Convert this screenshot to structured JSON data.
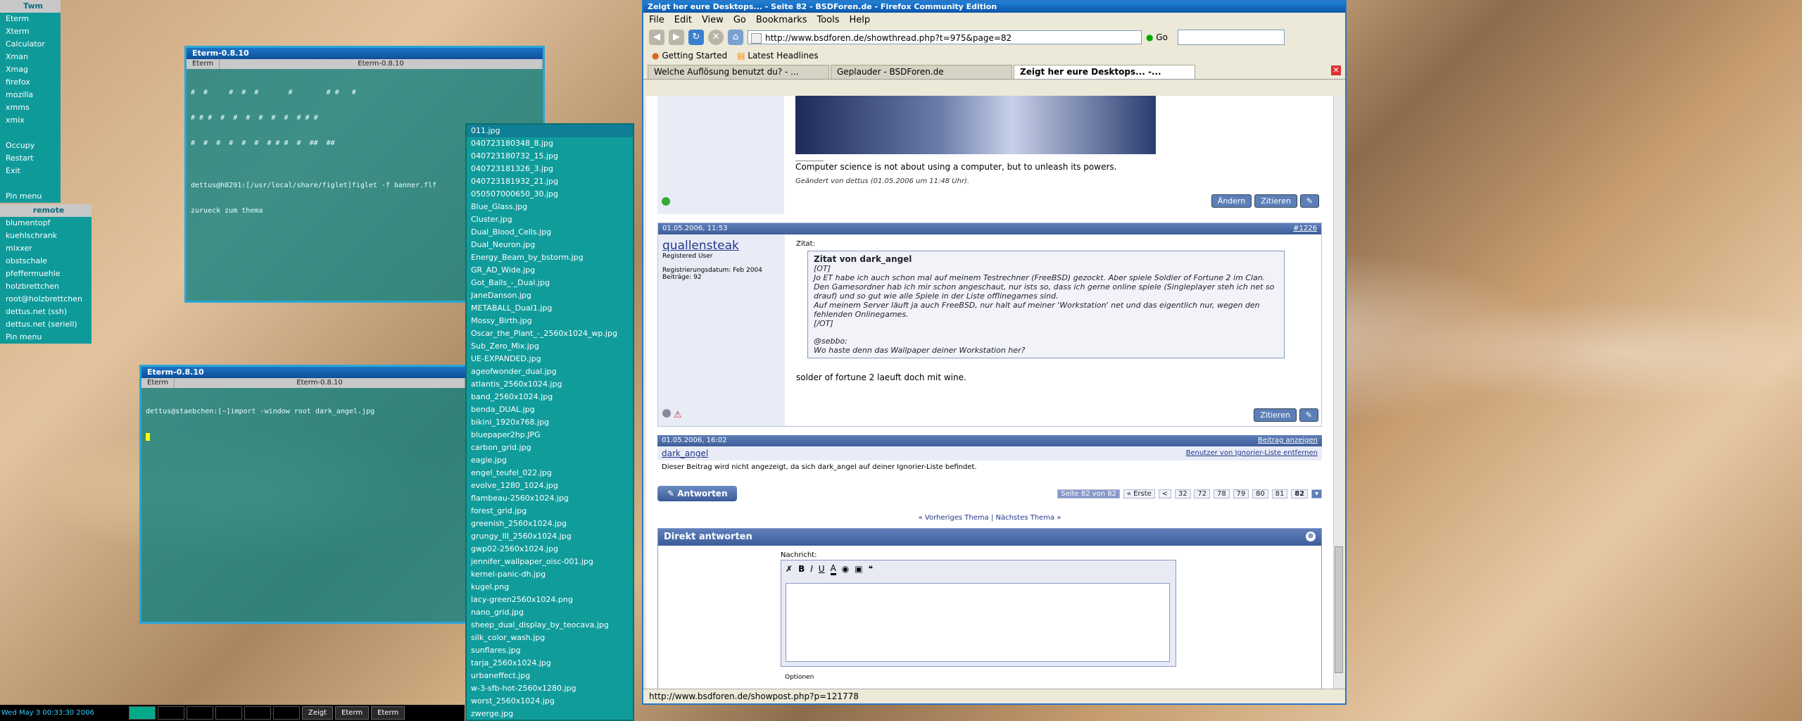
{
  "desktop": {
    "twm_menu": {
      "header": "Twm",
      "items": [
        "Eterm",
        "Xterm",
        "Calculator",
        "Xman",
        "Xmag",
        "firefox",
        "mozilla",
        "xmms",
        "xmix",
        "",
        "Occupy",
        "Restart",
        "Exit",
        "",
        "Pin menu"
      ],
      "remote_header": "remote",
      "remote_items": [
        "blumentopf",
        "kuehlschrank",
        "mixxer",
        "obstschale",
        "pfeffermuehle",
        "holzbrettchen",
        "root@holzbrettchen",
        "dettus.net (ssh)",
        "dettus.net (seriell)",
        "Pin menu"
      ]
    },
    "eterm1": {
      "title": "Eterm-0.8.10",
      "tab_label": "Eterm",
      "tab_title": "Eterm-0.8.10",
      "lines": [
        "#  #     #  #  #       #        # #   #",
        "# # #  #  #  #  #  #  #  # # #",
        "#  #  #  #  #  #  # # #  #  ##  ##",
        "",
        "dettus@h8291:[/usr/local/share/figlet]figlet -f banner.flf",
        "zurueck zum thema"
      ]
    },
    "eterm2": {
      "title": "Eterm-0.8.10",
      "tab_label": "Eterm",
      "tab_title": "Eterm-0.8.10",
      "lines": [
        "dettus@staebchen:[~]import -window root dark_angel.jpg"
      ]
    },
    "file_list": [
      "011.jpg",
      "040723180348_8.jpg",
      "040723180732_15.jpg",
      "040723181326_3.jpg",
      "040723181932_21.jpg",
      "050507000650_30.jpg",
      "Blue_Glass.jpg",
      "Cluster.jpg",
      "Dual_Blood_Cells.jpg",
      "Dual_Neuron.jpg",
      "Energy_Beam_by_bstorm.jpg",
      "GR_AD_Wide.jpg",
      "Got_Balls_-_Dual.jpg",
      "JaneDanson.jpg",
      "METABALL_Dual1.jpg",
      "Mossy_Birth.jpg",
      "Oscar_the_Plant_-_2560x1024_wp.jpg",
      "Sub_Zero_Mix.jpg",
      "UE-EXPANDED.jpg",
      "ageofwonder_dual.jpg",
      "atlantis_2560x1024.jpg",
      "band_2560x1024.jpg",
      "benda_DUAL.jpg",
      "bikini_1920x768.jpg",
      "bluepaper2hp.JPG",
      "carbon_grid.jpg",
      "eagle.jpg",
      "engel_teufel_022.jpg",
      "evolve_1280_1024.jpg",
      "flambeau-2560x1024.jpg",
      "forest_grid.jpg",
      "greenish_2560x1024.jpg",
      "grungy_III_2560x1024.jpg",
      "gwp02-2560x1024.jpg",
      "jennifer_wallpaper_oisc-001.jpg",
      "kernel-panic-dh.jpg",
      "kugel.png",
      "lacy-green2560x1024.png",
      "nano_grid.jpg",
      "sheep_dual_display_by_teocava.jpg",
      "silk_color_wash.jpg",
      "sunflares.jpg",
      "tarja_2560x1024.jpg",
      "urbaneffect.jpg",
      "w-3-sfb-hot-2560x1280.jpg",
      "worst_2560x1024.jpg",
      "zwerge.jpg"
    ],
    "taskbar": {
      "clock": "Wed May  3 00:33:30 2006",
      "buttons": [
        "Zeigt",
        "Eterm",
        "Eterm"
      ]
    }
  },
  "firefox": {
    "title": "Zeigt her eure Desktops... - Seite 82 - BSDForen.de - Firefox Community Edition",
    "menu": [
      "File",
      "Edit",
      "View",
      "Go",
      "Bookmarks",
      "Tools",
      "Help"
    ],
    "url": "http://www.bsdforen.de/showthread.php?t=975&page=82",
    "go_label": "Go",
    "bookmarks": [
      "Getting Started",
      "Latest Headlines"
    ],
    "tabs": [
      "Welche Auflösung benutzt du? - ...",
      "Geplauder - BSDForen.de",
      "Zeigt her eure Desktops... -..."
    ],
    "status_url": "http://www.bsdforen.de/showpost.php?p=121778",
    "page": {
      "signature": "Computer science is not about using a computer, but to unleash its powers.",
      "edited": "Geändert von dettus (01.05.2006 um 11:48 Uhr).",
      "btn_edit": "Ändern",
      "btn_quote": "Zitieren",
      "post2": {
        "date": "01.05.2006, 11:53",
        "number": "#1226",
        "user": "quallensteak",
        "role": "Registered User",
        "reg_date": "Registrierungsdatum: Feb 2004",
        "posts": "Beiträge: 92",
        "quote_label": "Zitat:",
        "quote_from": "Zitat von dark_angel",
        "quote_lines": [
          "[OT]",
          "Jo ET habe ich auch schon mal auf meinem Testrechner (FreeBSD) gezockt. Aber spiele Soldier of Fortune 2 im Clan.",
          "Den Gamesordner hab ich mir schon angeschaut, nur ists so, dass ich gerne online spiele (Singleplayer steh ich net so drauf) und so gut wie alle Spiele in der Liste offlinegames sind.",
          "Auf meinem Server läuft ja auch FreeBSD, nur halt auf meiner 'Workstation' net und das eigentlich nur, wegen den fehlenden Onlinegames.",
          "[/OT]",
          "",
          "@sebbo:",
          "Wo haste denn das Wallpaper deiner Workstation her?"
        ],
        "reply": "solder of fortune 2 laeuft doch mit wine."
      },
      "post3": {
        "date": "01.05.2006, 16:02",
        "show_link": "Beitrag anzeigen",
        "user": "dark_angel",
        "ignore_link": "Benutzer von Ignorier-Liste entfernen",
        "hidden_text": "Dieser Beitrag wird nicht angezeigt, da sich dark_angel auf deiner Ignorier-Liste befindet."
      },
      "reply_btn": "Antworten",
      "pager": [
        "Seite 82 von 82",
        "« Erste",
        "<",
        "32",
        "72",
        "78",
        "79",
        "80",
        "81",
        "82"
      ],
      "thread_nav": "« Vorheriges Thema | Nächstes Thema »",
      "quick_reply_title": "Direkt antworten",
      "message_label": "Nachricht:",
      "options_label": "Optionen"
    }
  }
}
